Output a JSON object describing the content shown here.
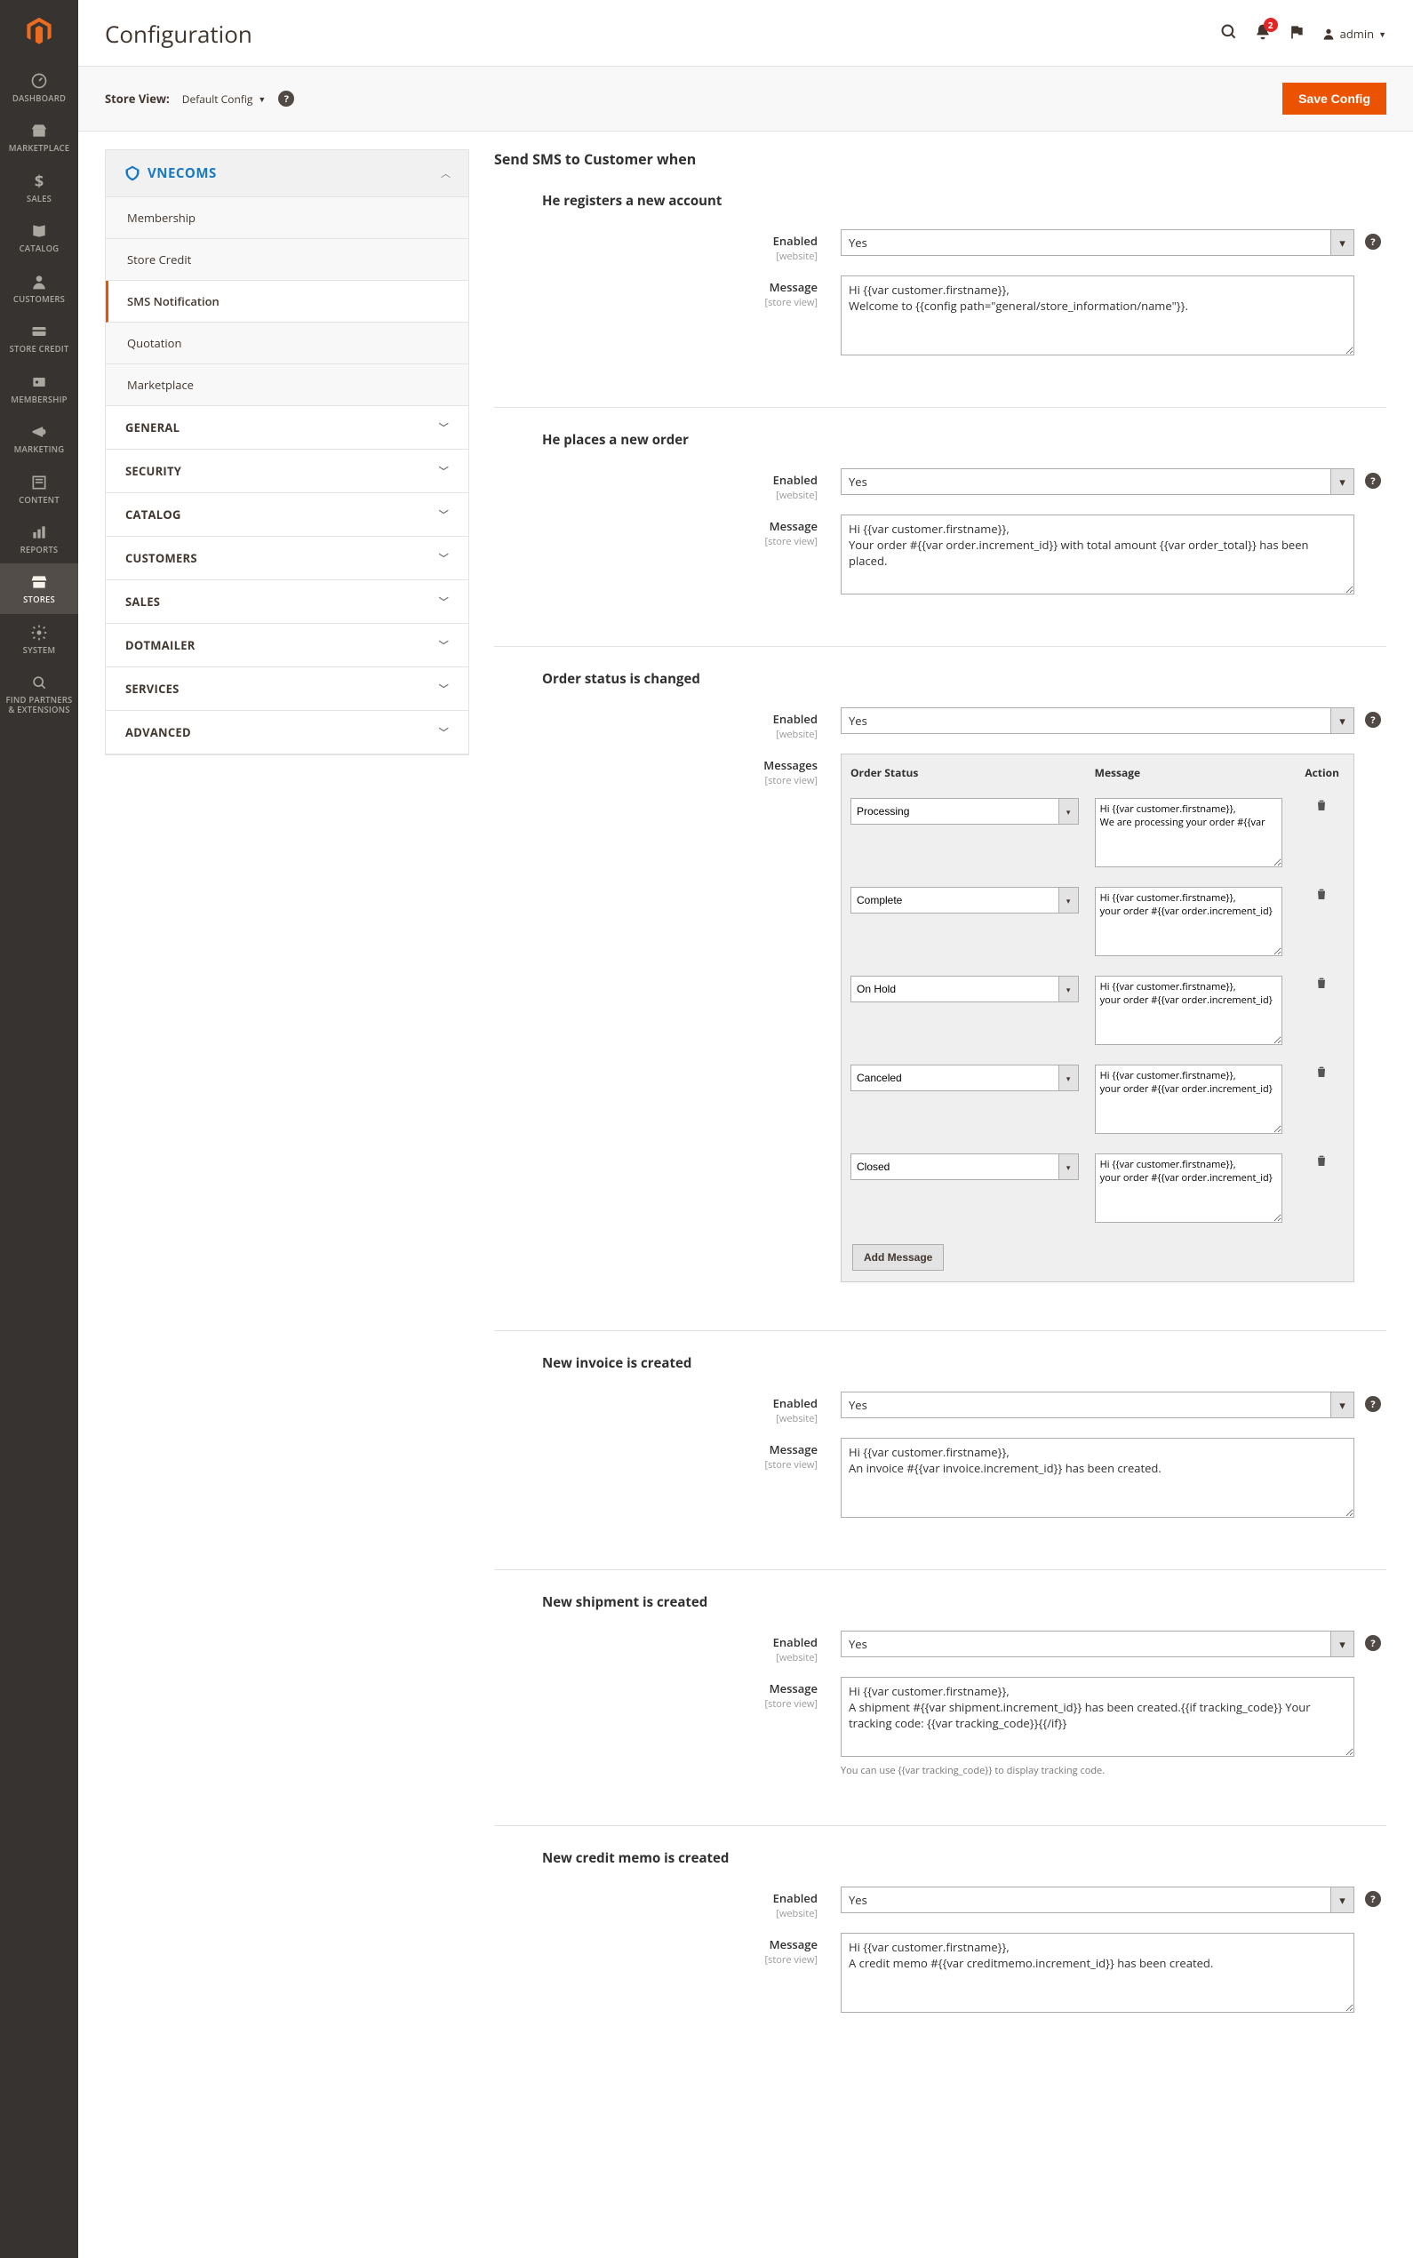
{
  "page": {
    "title": "Configuration"
  },
  "header": {
    "notif_count": "2",
    "user_label": "admin"
  },
  "store_bar": {
    "label": "Store View:",
    "value": "Default Config",
    "save": "Save Config"
  },
  "menu": [
    {
      "id": "dashboard",
      "label": "DASHBOARD"
    },
    {
      "id": "marketplace",
      "label": "MARKETPLACE"
    },
    {
      "id": "sales",
      "label": "SALES"
    },
    {
      "id": "catalog",
      "label": "CATALOG"
    },
    {
      "id": "customers",
      "label": "CUSTOMERS"
    },
    {
      "id": "storecredit",
      "label": "STORE CREDIT"
    },
    {
      "id": "membership",
      "label": "MEMBERSHIP"
    },
    {
      "id": "marketing",
      "label": "MARKETING"
    },
    {
      "id": "content",
      "label": "CONTENT"
    },
    {
      "id": "reports",
      "label": "REPORTS"
    },
    {
      "id": "stores",
      "label": "STORES"
    },
    {
      "id": "system",
      "label": "SYSTEM"
    },
    {
      "id": "partners",
      "label": "FIND PARTNERS & EXTENSIONS"
    }
  ],
  "nav": {
    "group": "VNECOMS",
    "items": [
      {
        "label": "Membership"
      },
      {
        "label": "Store Credit"
      },
      {
        "label": "SMS Notification",
        "active": true
      },
      {
        "label": "Quotation"
      },
      {
        "label": "Marketplace"
      }
    ],
    "sections": [
      "GENERAL",
      "SECURITY",
      "CATALOG",
      "CUSTOMERS",
      "SALES",
      "DOTMAILER",
      "SERVICES",
      "ADVANCED"
    ]
  },
  "form": {
    "heading": "Send SMS to Customer when",
    "scope_website": "[website]",
    "scope_storeview": "[store view]",
    "labels": {
      "enabled": "Enabled",
      "message": "Message",
      "messages": "Messages"
    },
    "select_yes": "Yes",
    "register": {
      "title": "He registers a new account",
      "msg": "Hi {{var customer.firstname}},\nWelcome to {{config path=\"general/store_information/name\"}}."
    },
    "order": {
      "title": "He places a new order",
      "msg": "Hi {{var customer.firstname}},\nYour order #{{var order.increment_id}} with total amount {{var order_total}} has been placed."
    },
    "status": {
      "title": "Order status is changed",
      "cols": {
        "status": "Order Status",
        "message": "Message",
        "action": "Action"
      },
      "rows": [
        {
          "status": "Processing",
          "msg": "Hi {{var customer.firstname}},\nWe are processing your order #{{var"
        },
        {
          "status": "Complete",
          "msg": "Hi {{var customer.firstname}},\nyour order #{{var order.increment_id}"
        },
        {
          "status": "On Hold",
          "msg": "Hi {{var customer.firstname}},\nyour order #{{var order.increment_id}"
        },
        {
          "status": "Canceled",
          "msg": "Hi {{var customer.firstname}},\nyour order #{{var order.increment_id}"
        },
        {
          "status": "Closed",
          "msg": "Hi {{var customer.firstname}},\nyour order #{{var order.increment_id}"
        }
      ],
      "add": "Add Message"
    },
    "invoice": {
      "title": "New invoice is created",
      "msg": "Hi {{var customer.firstname}},\nAn invoice #{{var invoice.increment_id}} has been created."
    },
    "shipment": {
      "title": "New shipment is created",
      "msg": "Hi {{var customer.firstname}},\nA shipment #{{var shipment.increment_id}} has been created.{{if tracking_code}} Your tracking code: {{var tracking_code}}{{/if}}",
      "note": "You can use {{var tracking_code}} to display tracking code."
    },
    "creditmemo": {
      "title": "New credit memo is created",
      "msg": "Hi {{var customer.firstname}},\nA credit memo #{{var creditmemo.increment_id}} has been created."
    }
  }
}
